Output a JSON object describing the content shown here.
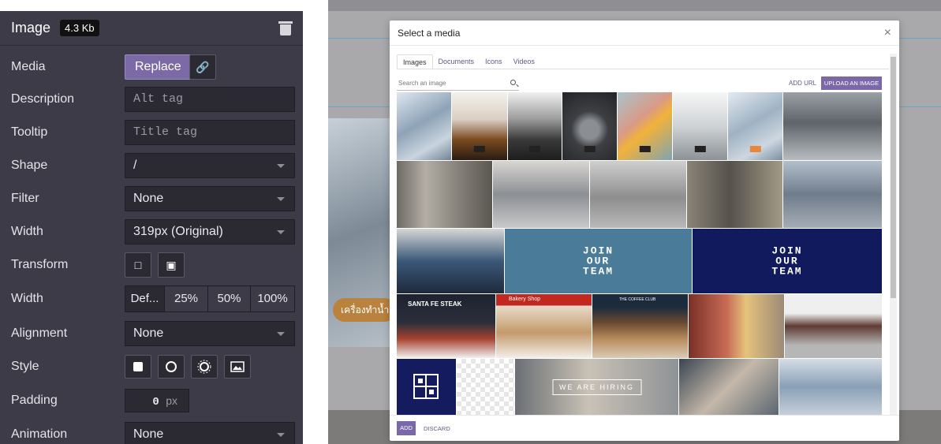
{
  "panel": {
    "title": "Image",
    "size_badge": "4.3 Kb",
    "rows": {
      "media": {
        "label": "Media",
        "replace_label": "Replace"
      },
      "description": {
        "label": "Description",
        "placeholder": "Alt tag"
      },
      "tooltip": {
        "label": "Tooltip",
        "placeholder": "Title tag"
      },
      "shape": {
        "label": "Shape",
        "value": "/"
      },
      "filter": {
        "label": "Filter",
        "value": "None"
      },
      "width": {
        "label": "Width",
        "value": "319px (Original)"
      },
      "transform": {
        "label": "Transform"
      },
      "width2": {
        "label": "Width",
        "options": [
          "Def...",
          "25%",
          "50%",
          "100%"
        ]
      },
      "alignment": {
        "label": "Alignment",
        "value": "None"
      },
      "style": {
        "label": "Style"
      },
      "padding": {
        "label": "Padding",
        "value": "0",
        "unit": "px"
      },
      "animation": {
        "label": "Animation",
        "value": "None"
      }
    }
  },
  "background": {
    "pill_text": "เครื่องทำน้ำ"
  },
  "modal": {
    "title": "Select a media",
    "close_glyph": "×",
    "tabs": [
      "Images",
      "Documents",
      "Icons",
      "Videos"
    ],
    "search_placeholder": "Search an image",
    "add_url_label": "ADD URL",
    "upload_label": "UPLOAD AN IMAGE",
    "add_label": "ADD",
    "discard_label": "DISCARD",
    "tile_texts": {
      "join": "JOIN\nOUR\nTEAM",
      "hiring": "WE ARE HIRING",
      "steak": "SANTA FE STEAK",
      "bakery": "Bakery Shop",
      "coffee": "THE COFFEE CLUB"
    }
  }
}
